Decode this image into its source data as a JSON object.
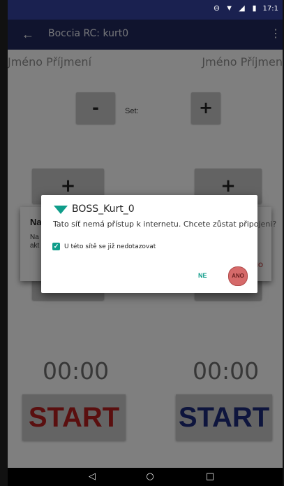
{
  "status_bar": {
    "time": "17:1",
    "icons": [
      "do-not-disturb-icon",
      "wifi-icon",
      "signal-icon",
      "battery-icon"
    ]
  },
  "app_bar": {
    "title": "Boccia RC: kurt0",
    "back_icon": "arrow-back-icon",
    "menu_icon": "overflow-menu-icon"
  },
  "players": {
    "left_name": "Jméno Příjmení",
    "right_name": "Jméno Příjmen"
  },
  "set": {
    "minus_label": "-",
    "label": "Set:",
    "plus_label": "+"
  },
  "score_buttons": {
    "left_plus": "+",
    "right_plus": "+"
  },
  "under_dialog": {
    "title": "Na",
    "text": "Na\nakt",
    "action": "NO"
  },
  "timers": {
    "left": "00:00",
    "right": "00:00"
  },
  "start_buttons": {
    "left_label": "START",
    "right_label": "START",
    "left_color": "#b51f1f",
    "right_color": "#1d2a7a"
  },
  "wifi_dialog": {
    "ssid": "BOSS_Kurt_0",
    "message": "Tato síť nemá přístup k internetu. Chcete zůstat připojeni?",
    "checkbox_label": "U této sítě se již nedotazovat",
    "checkbox_checked": true,
    "negative_label": "NE",
    "positive_label": "ANO",
    "accent_color": "#0f9d8a"
  },
  "nav_bar": {
    "back": "◁",
    "home": "○",
    "recent": "□"
  }
}
